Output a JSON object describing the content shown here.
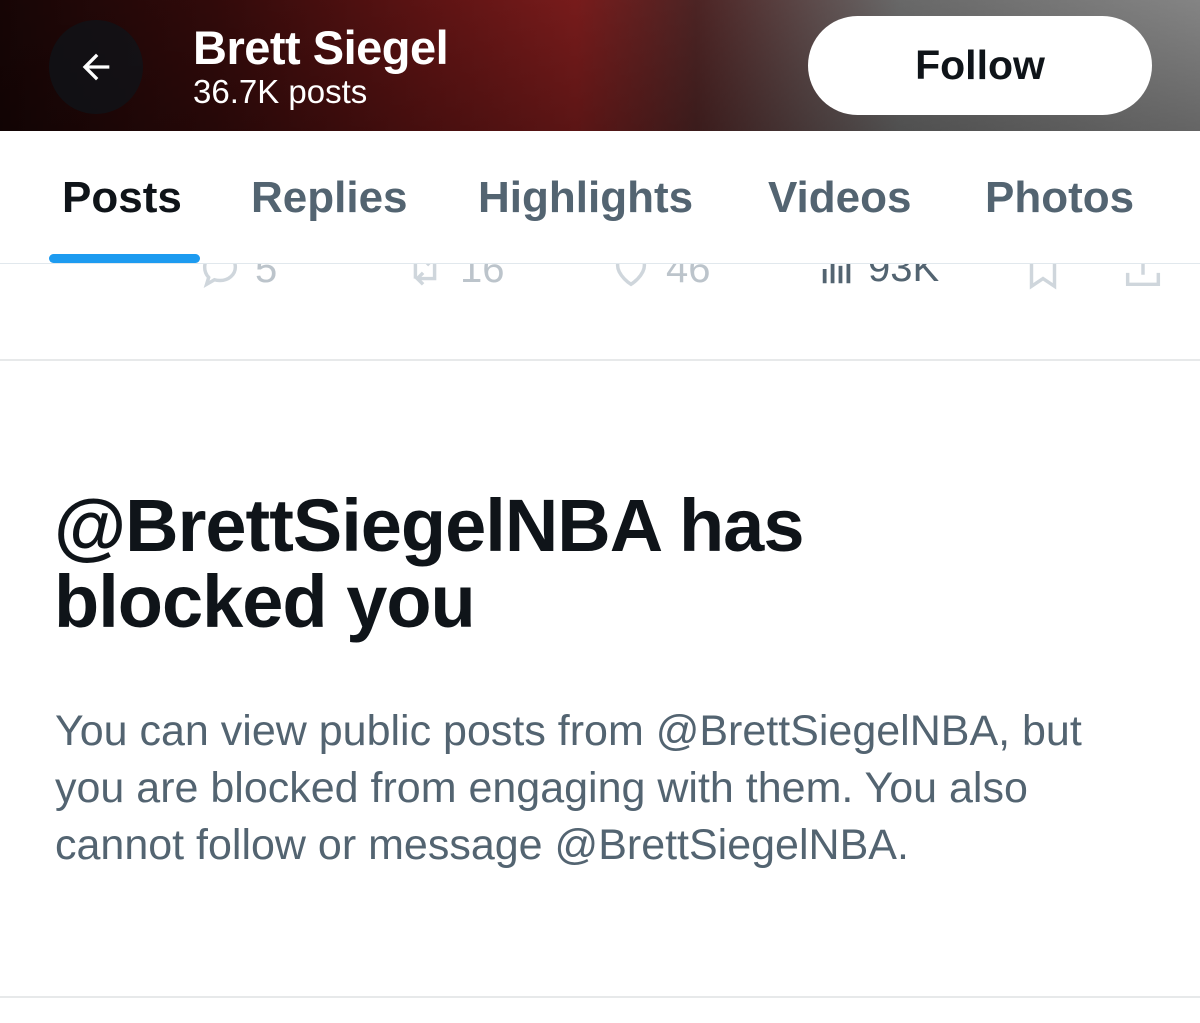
{
  "header": {
    "name": "Brett Siegel",
    "post_count": "36.7K posts",
    "follow_label": "Follow"
  },
  "tabs": [
    {
      "label": "Posts",
      "active": true
    },
    {
      "label": "Replies",
      "active": false
    },
    {
      "label": "Highlights",
      "active": false
    },
    {
      "label": "Videos",
      "active": false
    },
    {
      "label": "Photos",
      "active": false
    }
  ],
  "post_actions": {
    "replies": "5",
    "reposts": "16",
    "likes": "46",
    "views": "93K",
    "icons": [
      "reply-icon",
      "repost-icon",
      "like-icon",
      "views-icon",
      "bookmark-icon",
      "share-icon"
    ]
  },
  "blocked": {
    "title": "@BrettSiegelNBA has blocked you",
    "description": "You can view public posts from @BrettSiegelNBA, but you are blocked from engaging with them. You also cannot follow or message @BrettSiegelNBA."
  },
  "colors": {
    "accent": "#1d9bf0",
    "text_primary": "#0f1419",
    "text_secondary": "#536471"
  }
}
